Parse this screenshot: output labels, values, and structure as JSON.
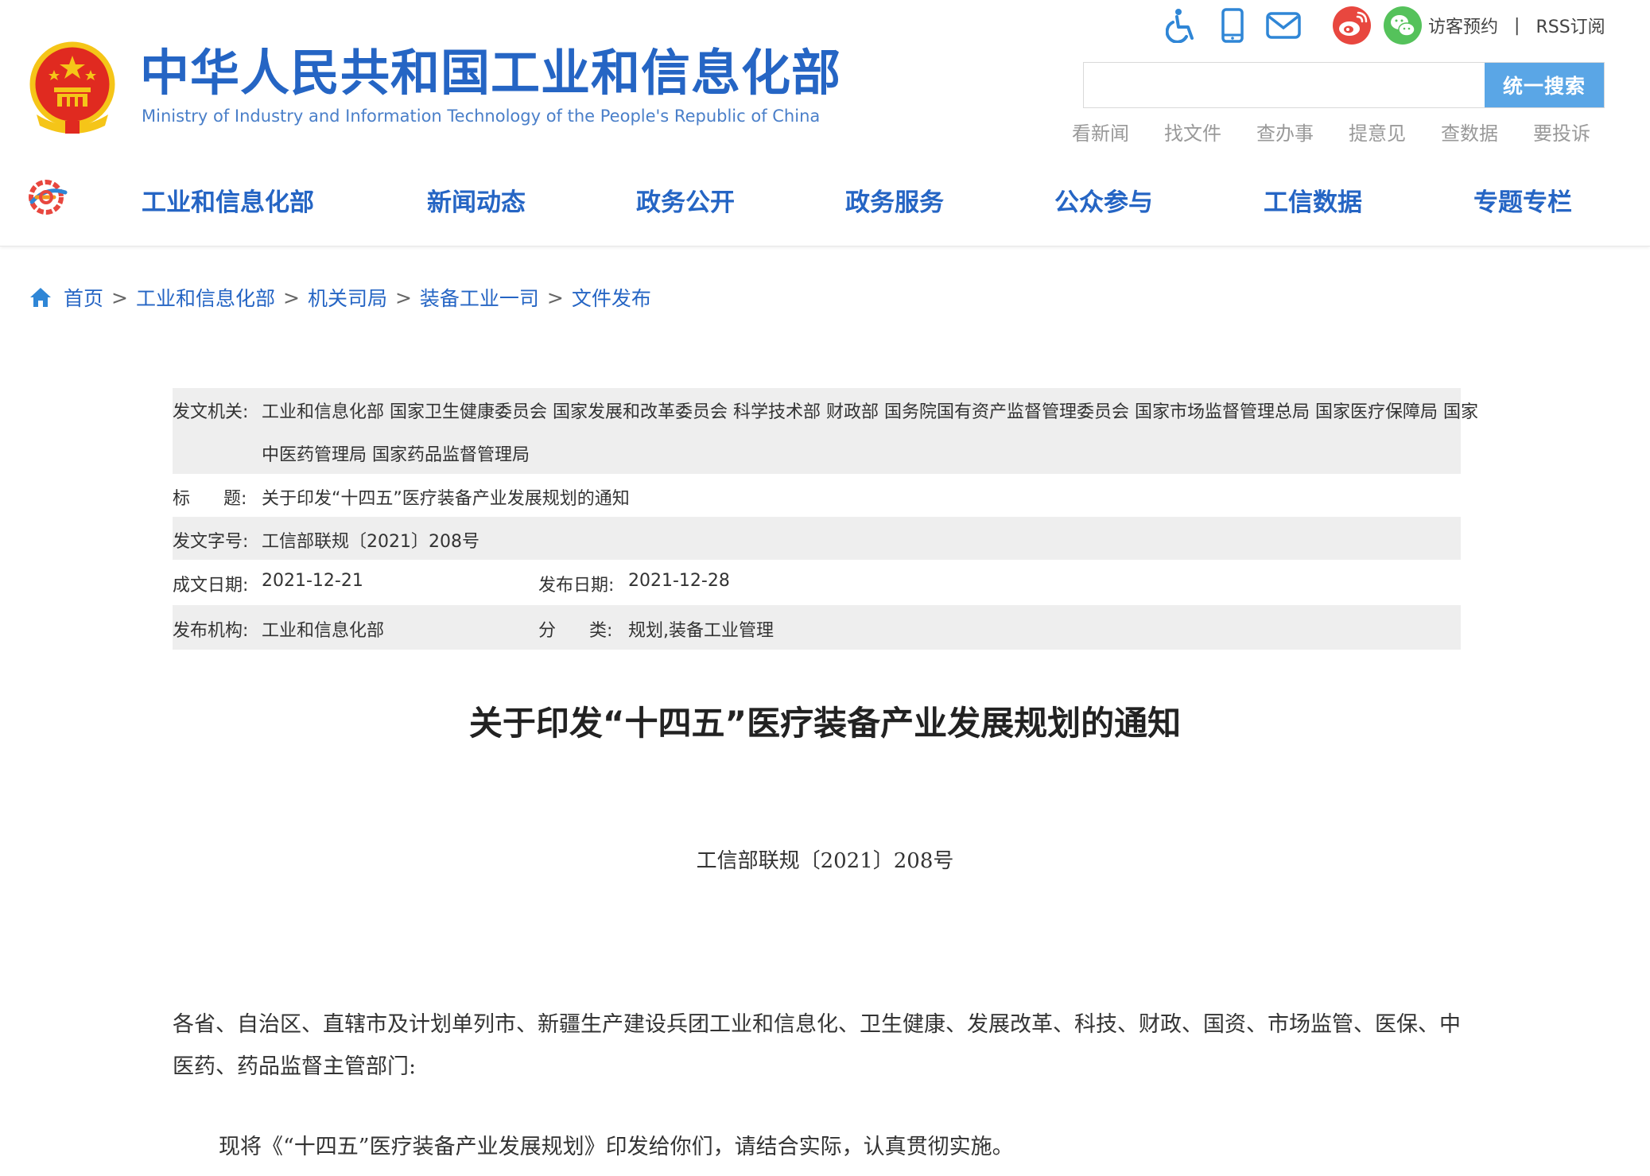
{
  "header": {
    "title_cn": "中华人民共和国工业和信息化部",
    "title_en": "Ministry of Industry and Information Technology of the People's Republic of China",
    "top_icons": [
      "accessibility-icon",
      "mobile-icon",
      "mail-icon",
      "weibo-icon",
      "wechat-icon"
    ],
    "top_links": [
      "访客预约",
      "RSS订阅"
    ],
    "top_links_sep": "|",
    "search": {
      "placeholder": "",
      "value": "",
      "button_label": "统一搜索"
    },
    "quick_links": [
      "看新闻",
      "找文件",
      "查办事",
      "提意见",
      "查数据",
      "要投诉"
    ]
  },
  "nav": [
    "工业和信息化部",
    "新闻动态",
    "政务公开",
    "政务服务",
    "公众参与",
    "工信数据",
    "专题专栏"
  ],
  "breadcrumb": {
    "items": [
      "首页",
      "工业和信息化部",
      "机关司局",
      "装备工业一司",
      "文件发布"
    ],
    "separator": ">"
  },
  "meta": {
    "issuer_label": "发文机关:",
    "issuer_line1": "工业和信息化部 国家卫生健康委员会 国家发展和改革委员会 科学技术部 财政部 国务院国有资产监督管理委员会 国家市场监督管理总局 国家医疗保障局 国家",
    "issuer_line2": "中医药管理局 国家药品监督管理局",
    "title_label": "标      题:",
    "title_value": "关于印发“十四五”医疗装备产业发展规划的通知",
    "docno_label": "发文字号:",
    "docno_value": "工信部联规〔2021〕208号",
    "created_label": "成文日期:",
    "created_value": "2021-12-21",
    "published_label": "发布日期:",
    "published_value": "2021-12-28",
    "org_label": "发布机构:",
    "org_value": "工业和信息化部",
    "category_label": "分      类:",
    "category_value": "规划,装备工业管理"
  },
  "article": {
    "title": "关于印发“十四五”医疗装备产业发展规划的通知",
    "doc_number": "工信部联规〔2021〕208号",
    "addressee": "各省、自治区、直辖市及计划单列市、新疆生产建设兵团工业和信息化、卫生健康、发展改革、科技、财政、国资、市场监管、医保、中医药、药品监督主管部门:",
    "body": "现将《“十四五”医疗装备产业发展规划》印发给你们，请结合实际，认真贯彻实施。"
  },
  "colors": {
    "brand_blue": "#2565c4",
    "search_button": "#5aa6e6",
    "meta_row_gray": "#eeeeee",
    "weibo_red": "#e8473f",
    "wechat_green": "#55c25b"
  }
}
